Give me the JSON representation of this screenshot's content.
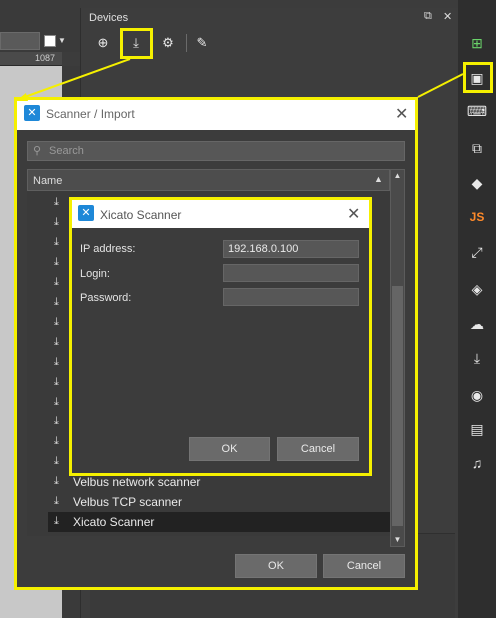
{
  "ruler": {
    "mark": "1087"
  },
  "devices": {
    "title": "Devices"
  },
  "scanner": {
    "title": "Scanner / Import",
    "search_placeholder": "Search",
    "column_name": "Name",
    "items": [
      {
        "label": ""
      },
      {
        "label": ""
      },
      {
        "label": ""
      },
      {
        "label": ""
      },
      {
        "label": ""
      },
      {
        "label": ""
      },
      {
        "label": ""
      },
      {
        "label": ""
      },
      {
        "label": ""
      },
      {
        "label": ""
      },
      {
        "label": ""
      },
      {
        "label": ""
      },
      {
        "label": ""
      },
      {
        "label": ""
      },
      {
        "label": "Velbus network scanner"
      },
      {
        "label": "Velbus TCP scanner"
      },
      {
        "label": "Xicato Scanner"
      }
    ],
    "ok_label": "OK",
    "cancel_label": "Cancel"
  },
  "xicato": {
    "title": "Xicato Scanner",
    "ip_label": "IP address:",
    "ip_value": "192.168.0.100",
    "login_label": "Login:",
    "login_value": "",
    "password_label": "Password:",
    "password_value": "",
    "ok_label": "OK",
    "cancel_label": "Cancel"
  },
  "right_bar": {
    "js_label": "JS"
  },
  "colors": {
    "highlight": "#f5f000",
    "accent": "#1e88d8",
    "js": "#ff8a2a"
  }
}
